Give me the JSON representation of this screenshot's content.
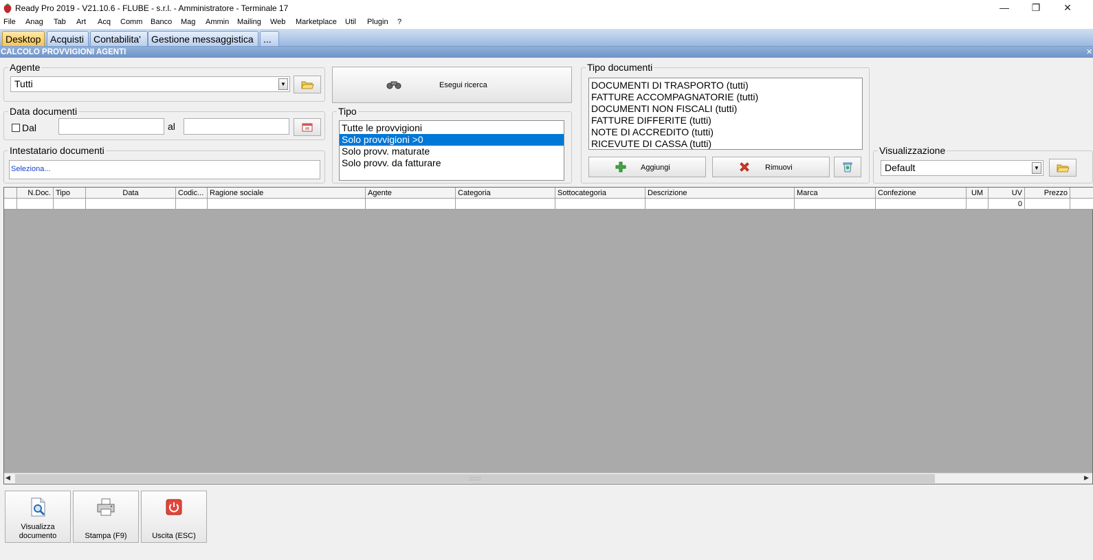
{
  "window": {
    "title": "Ready Pro 2019 - V21.10.6 - FLUBE - s.r.l. - Amministratore - Terminale 17",
    "minimize": "—",
    "restore": "❐",
    "close": "✕"
  },
  "menu": [
    "File",
    "Anag",
    "Tab",
    "Art",
    "Acq",
    "Comm",
    "Banco",
    "Mag",
    "Ammin",
    "Mailing",
    "Web",
    "Marketplace",
    "Util",
    "Plugin",
    "?"
  ],
  "tabs": [
    "Desktop",
    "Acquisti",
    "Contabilita'",
    "Gestione messaggistica",
    "..."
  ],
  "page_header": "CALCOLO PROVVIGIONI AGENTI",
  "page_close": "✕",
  "agente": {
    "label": "Agente",
    "value": "Tutti"
  },
  "data_documenti": {
    "label": "Data documenti",
    "dal_label": "Dal",
    "al_label": "al",
    "dal_value": "",
    "al_value": ""
  },
  "intestatario": {
    "label": "Intestatario documenti",
    "value": "Seleziona..."
  },
  "search_button": "Esegui ricerca",
  "tipo": {
    "label": "Tipo",
    "items": [
      "Tutte le provvigioni",
      "Solo provvigioni >0",
      "Solo provv. maturate",
      "Solo provv. da fatturare"
    ],
    "selected_index": 1
  },
  "tipo_documenti": {
    "label": "Tipo documenti",
    "items": [
      "DOCUMENTI DI TRASPORTO (tutti)",
      "FATTURE ACCOMPAGNATORIE (tutti)",
      "DOCUMENTI NON FISCALI (tutti)",
      "FATTURE DIFFERITE (tutti)",
      "NOTE DI ACCREDITO (tutti)",
      "RICEVUTE DI CASSA (tutti)"
    ],
    "add_label": "Aggiungi",
    "remove_label": "Rimuovi"
  },
  "visualizzazione": {
    "label": "Visualizzazione",
    "value": "Default"
  },
  "grid": {
    "columns": [
      "",
      "N.Doc.",
      "Tipo",
      "Data",
      "Codic...",
      "Ragione sociale",
      "Agente",
      "Categoria",
      "Sottocategoria",
      "Descrizione",
      "Marca",
      "Confezione",
      "UM",
      "UV",
      "Prezzo"
    ],
    "row": [
      "",
      "",
      "",
      "",
      "",
      "",
      "",
      "",
      "",
      "",
      "",
      "",
      "",
      "0",
      ""
    ],
    "scroll_grip": "::::::::",
    "scroll_left": "◀",
    "scroll_right": "▶"
  },
  "toolbar": {
    "visualizza_line1": "Visualizza",
    "visualizza_line2": "documento",
    "stampa": "Stampa (F9)",
    "uscita": "Uscita (ESC)"
  },
  "colors": {
    "accent": "#0078d7",
    "tab_active": "#f7c456",
    "header": "#7b9bc8"
  }
}
